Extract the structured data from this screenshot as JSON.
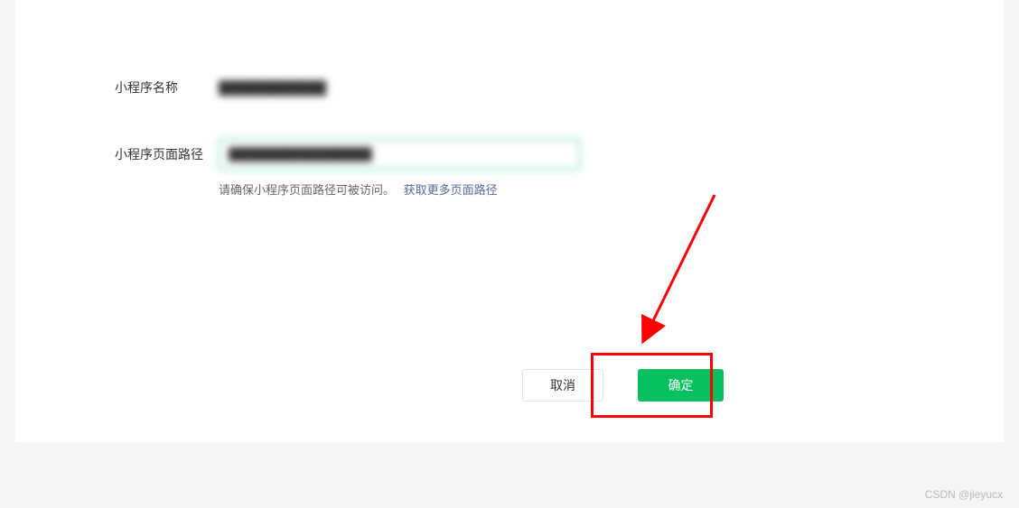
{
  "form": {
    "name_label": "小程序名称",
    "name_value": "████████████",
    "path_label": "小程序页面路径",
    "path_value": "████████████████",
    "help_text": "请确保小程序页面路径可被访问。",
    "help_link": "获取更多页面路径"
  },
  "footer": {
    "cancel_label": "取消",
    "confirm_label": "确定"
  },
  "watermark": "CSDN @jieyucx"
}
